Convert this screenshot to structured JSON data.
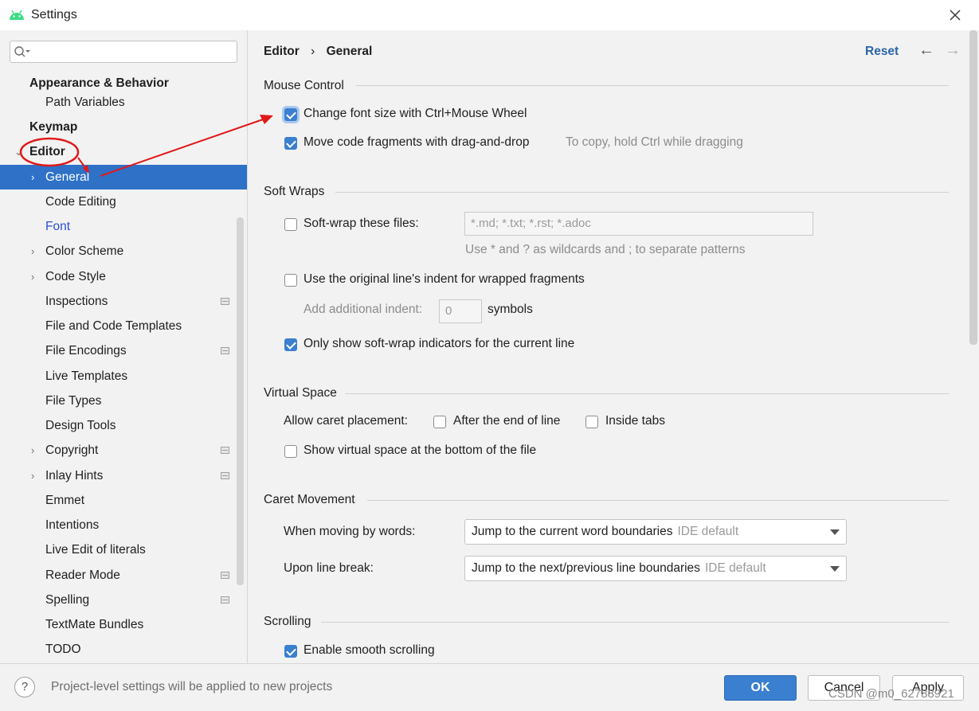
{
  "window": {
    "title": "Settings"
  },
  "search": {
    "placeholder": ""
  },
  "sidebar": {
    "items": [
      {
        "label": "Appearance & Behavior"
      },
      {
        "label": "Path Variables"
      },
      {
        "label": "Keymap"
      },
      {
        "label": "Editor"
      },
      {
        "label": "General"
      },
      {
        "label": "Code Editing"
      },
      {
        "label": "Font"
      },
      {
        "label": "Color Scheme"
      },
      {
        "label": "Code Style"
      },
      {
        "label": "Inspections"
      },
      {
        "label": "File and Code Templates"
      },
      {
        "label": "File Encodings"
      },
      {
        "label": "Live Templates"
      },
      {
        "label": "File Types"
      },
      {
        "label": "Design Tools"
      },
      {
        "label": "Copyright"
      },
      {
        "label": "Inlay Hints"
      },
      {
        "label": "Emmet"
      },
      {
        "label": "Intentions"
      },
      {
        "label": "Live Edit of literals"
      },
      {
        "label": "Reader Mode"
      },
      {
        "label": "Spelling"
      },
      {
        "label": "TextMate Bundles"
      },
      {
        "label": "TODO"
      }
    ]
  },
  "header": {
    "breadcrumb_parent": "Editor",
    "breadcrumb_sep": "›",
    "breadcrumb_current": "General",
    "reset_label": "Reset"
  },
  "mouse_control": {
    "title": "Mouse Control",
    "font_size_label": "Change font size with Ctrl+Mouse Wheel",
    "font_size_checked": true,
    "drag_drop_label": "Move code fragments with drag-and-drop",
    "drag_drop_checked": true,
    "drag_drop_hint": "To copy, hold Ctrl while dragging"
  },
  "soft_wraps": {
    "title": "Soft Wraps",
    "soft_wrap_files_label": "Soft-wrap these files:",
    "soft_wrap_files_checked": false,
    "soft_wrap_files_value": "*.md; *.txt; *.rst; *.adoc",
    "patterns_hint": "Use * and ? as wildcards and ; to separate patterns",
    "original_indent_label": "Use the original line's indent for wrapped fragments",
    "original_indent_checked": false,
    "additional_indent_label": "Add additional indent:",
    "additional_indent_value": "0",
    "symbols_label": "symbols",
    "indicators_label": "Only show soft-wrap indicators for the current line",
    "indicators_checked": true
  },
  "virtual_space": {
    "title": "Virtual Space",
    "caret_placement_label": "Allow caret placement:",
    "after_end_label": "After the end of line",
    "after_end_checked": false,
    "inside_tabs_label": "Inside tabs",
    "inside_tabs_checked": false,
    "virtual_bottom_label": "Show virtual space at the bottom of the file",
    "virtual_bottom_checked": false
  },
  "caret_movement": {
    "title": "Caret Movement",
    "by_words_label": "When moving by words:",
    "by_words_value": "Jump to the current word boundaries",
    "by_words_hint": "IDE default",
    "line_break_label": "Upon line break:",
    "line_break_value": "Jump to the next/previous line boundaries",
    "line_break_hint": "IDE default"
  },
  "scrolling": {
    "title": "Scrolling",
    "smooth_label": "Enable smooth scrolling",
    "smooth_checked": true
  },
  "footer": {
    "help_label": "?",
    "info_text": "Project-level settings will be applied to new projects",
    "ok_label": "OK",
    "cancel_label": "Cancel",
    "apply_label": "Apply"
  },
  "watermark": "CSDN @m0_62788921",
  "colors": {
    "selection": "#2e71c7",
    "link": "#2b66a8",
    "accent_checkbox": "#3b7fcf",
    "annotation_red": "#e01919"
  }
}
